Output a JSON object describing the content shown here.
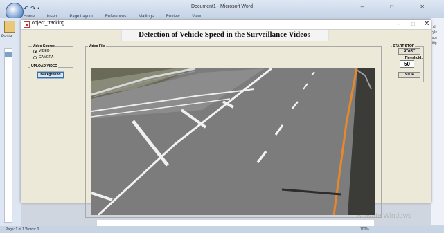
{
  "word": {
    "title": "Document1 - Microsoft Word",
    "quick_access": "↶ ↷ •",
    "tabs": [
      "Home",
      "Insert",
      "Page Layout",
      "References",
      "Mailings",
      "Review",
      "View"
    ],
    "window_controls": "– □ ✕",
    "paste_label": "Paste",
    "right_fragments": [
      "nd",
      "ryle",
      "ace",
      "litig"
    ],
    "watermark": "Activate Windows",
    "status_left": "Page: 1 of 1   Words: 0",
    "status_right": "100%"
  },
  "figure": {
    "title": "object_tracking",
    "minimize": "–",
    "maximize": "□",
    "close": "✕",
    "heading": "Detection of Vehicle Speed in the Surveillance Videos",
    "video_source": {
      "title": "Video Source",
      "options": [
        {
          "label": "VIDEO",
          "selected": true
        },
        {
          "label": "CAMERA",
          "selected": false
        }
      ]
    },
    "upload_video": {
      "title": "UPLOAD VIDEO",
      "button": "Background"
    },
    "video_file": {
      "title": "Video File"
    },
    "start_stop": {
      "title": "START STOP",
      "start_button": "START",
      "threshold_label": "Threshold:",
      "threshold_value": "50",
      "stop_button": "STOP"
    }
  },
  "colors": {
    "figure_bg": "#ece9d8",
    "road": "#7c7c7c",
    "lane_edge": "#e8882a",
    "grass": "#5a5a4e"
  }
}
